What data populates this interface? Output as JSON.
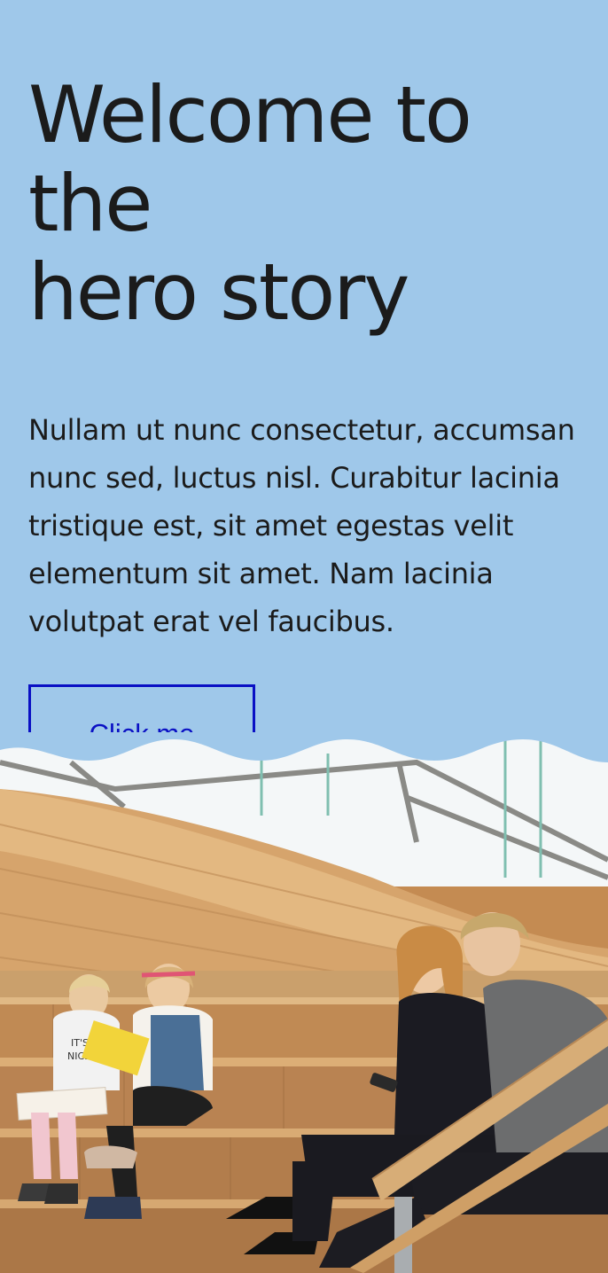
{
  "hero": {
    "title_line1": "Welcome to the",
    "title_line2": "hero story",
    "body": "Nullam ut nunc consectetur, accumsan nunc sed, luctus nisl. Curabitur lacinia tristique est, sit amet egestas velit elementum sit amet. Nam lacinia volutpat erat vel faucibus.",
    "button_label": "Click me"
  },
  "image": {
    "book_lines": [
      "IT'S A",
      "NICE DAY"
    ]
  },
  "colors": {
    "background": "#9fc8ea",
    "button_border": "#0a10c4",
    "text": "#1b1b1b"
  }
}
